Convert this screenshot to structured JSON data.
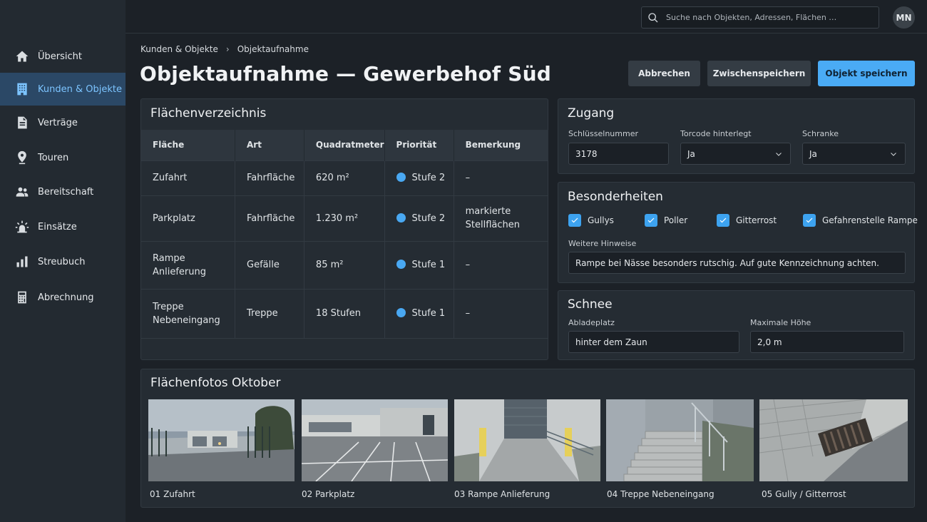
{
  "sidebar": {
    "items": [
      {
        "label": "Übersicht",
        "icon": "home-icon"
      },
      {
        "label": "Kunden & Objekte",
        "icon": "building-icon"
      },
      {
        "label": "Verträge",
        "icon": "document-icon"
      },
      {
        "label": "Touren",
        "icon": "map-pin-icon"
      },
      {
        "label": "Bereitschaft",
        "icon": "people-icon"
      },
      {
        "label": "Einsätze",
        "icon": "alert-light-icon"
      },
      {
        "label": "Streubuch",
        "icon": "bar-chart-icon"
      },
      {
        "label": "Abrechnung",
        "icon": "calculator-icon"
      }
    ],
    "active_index": 1
  },
  "topbar": {
    "search_placeholder": "Suche nach Objekten, Adressen, Flächen …",
    "avatar_initials": "MN"
  },
  "header": {
    "breadcrumb": [
      "Kunden & Objekte",
      "Objektaufnahme"
    ],
    "title": "Objektaufnahme — Gewerbehof Süd",
    "buttons": {
      "cancel": "Abbrechen",
      "save_draft": "Zwischenspeichern",
      "save": "Objekt speichern"
    }
  },
  "areas": {
    "title": "Flächenverzeichnis",
    "columns": [
      "Fläche",
      "Art",
      "Quadratmeter",
      "Priorität",
      "Bemerkung"
    ],
    "rows": [
      {
        "flaeche": "Zufahrt",
        "art": "Fahrfläche",
        "qm": "620 m²",
        "prio": "Stufe 2",
        "bemerkung": "–"
      },
      {
        "flaeche": "Parkplatz",
        "art": "Fahrfläche",
        "qm": "1.230 m²",
        "prio": "Stufe 2",
        "bemerkung": "markierte Stellflächen"
      },
      {
        "flaeche": "Rampe Anlieferung",
        "art": "Gefälle",
        "qm": "85 m²",
        "prio": "Stufe 1",
        "bemerkung": "–"
      },
      {
        "flaeche": "Treppe Nebeneingang",
        "art": "Treppe",
        "qm": "18 Stufen",
        "prio": "Stufe 1",
        "bemerkung": "–"
      }
    ]
  },
  "access": {
    "title": "Zugang",
    "key_label": "Schlüsselnummer",
    "key_value": "3178",
    "gate_label": "Torcode hinterlegt",
    "gate_value": "Ja",
    "barrier_label": "Schranke",
    "barrier_value": "Ja"
  },
  "features": {
    "title": "Besonderheiten",
    "checks": [
      "Gullys",
      "Poller",
      "Gitterrost",
      "Gefahrenstelle Rampe"
    ],
    "notes_label": "Weitere Hinweise",
    "notes_value": "Rampe bei Nässe besonders rutschig. Auf gute Kennzeichnung achten."
  },
  "snow": {
    "title": "Schnee",
    "dump_label": "Abladeplatz",
    "dump_value": "hinter dem Zaun",
    "max_label": "Maximale Höhe",
    "max_value": "2,0 m"
  },
  "photos": {
    "title": "Flächenfotos Oktober",
    "items": [
      "01 Zufahrt",
      "02 Parkplatz",
      "03 Rampe Anlieferung",
      "04 Treppe Nebeneingang",
      "05 Gully / Gitterrost"
    ]
  },
  "colors": {
    "accent": "#4aabf5",
    "active_nav_bg": "#2b4866",
    "priority_dot": "#49a8f2"
  }
}
